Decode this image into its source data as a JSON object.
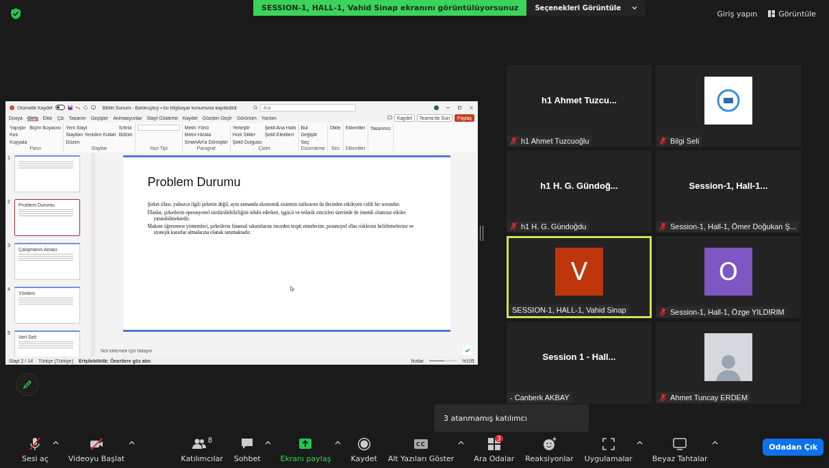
{
  "top_bar": {
    "sharing_banner": "SESSION-1, HALL-1, Vahid Sinap ekranını görüntülüyorsunuz",
    "view_options": "Seçenekleri Görüntüle",
    "sign_in": "Giriş yapın",
    "view": "Görüntüle"
  },
  "shared_screen": {
    "titlebar": {
      "autosave": "Otomatik Kaydet",
      "autosave_on": false,
      "doc_title": "Bildiri Sunum - Bankruptcy • bu bilgisayar konumuna kaydedildi",
      "search_placeholder": "Ara"
    },
    "ribbon_tabs": [
      {
        "label": "Dosya",
        "selected": false
      },
      {
        "label": "Giriş",
        "selected": true
      },
      {
        "label": "Ekle",
        "selected": false
      },
      {
        "label": "Çiz",
        "selected": false
      },
      {
        "label": "Tasarım",
        "selected": false
      },
      {
        "label": "Geçişler",
        "selected": false
      },
      {
        "label": "Animasyonlar",
        "selected": false
      },
      {
        "label": "Slayt Gösterisi",
        "selected": false
      },
      {
        "label": "Kaydet",
        "selected": false
      },
      {
        "label": "Gözden Geçir",
        "selected": false
      },
      {
        "label": "Görünüm",
        "selected": false
      },
      {
        "label": "Yardım",
        "selected": false
      }
    ],
    "ribbon_buttons": [
      {
        "label": "Kaydet",
        "kind": "plain"
      },
      {
        "label": "Teams'de Sun",
        "kind": "plain"
      },
      {
        "label": "Paylaş",
        "kind": "accent"
      }
    ],
    "ribbon_groups": [
      {
        "label": "Pano",
        "items": [
          "Yapıştır",
          "Kes",
          "Kopyala",
          "Biçim Boyacısı"
        ]
      },
      {
        "label": "Slaytlar",
        "items": [
          "Yeni Slayt",
          "Slaytları Yeniden Kullan",
          "Düzen",
          "Sıfırla",
          "Bölüm"
        ]
      },
      {
        "label": "Yazı Tipi"
      },
      {
        "label": "Paragraf",
        "items": [
          "Metin Yönü",
          "Metni Hizala",
          "SmartArt'a Dönüştür"
        ]
      },
      {
        "label": "Çizim",
        "items": [
          "Yerleştir",
          "Hızlı Stiller",
          "Şekil Dolgusu",
          "Şekil Ana Hattı",
          "Şekil Efektleri"
        ]
      },
      {
        "label": "Düzenleme",
        "items": [
          "Bul",
          "Değiştir",
          "Seç"
        ]
      },
      {
        "label": "Ses",
        "items": [
          "Dikte"
        ]
      },
      {
        "label": "Eklentiler",
        "items": [
          "Eklentiler"
        ]
      },
      {
        "items": [
          "Tasarımcı"
        ]
      }
    ],
    "slides": [
      {
        "number": "1",
        "selected": false
      },
      {
        "number": "2",
        "title": "Problem Durumu",
        "selected": true
      },
      {
        "number": "3",
        "title": "Çalışmanın Amacı",
        "selected": false
      },
      {
        "number": "4",
        "title": "Yöntem",
        "selected": false
      },
      {
        "number": "5",
        "title": "Veri Seti",
        "selected": false
      }
    ],
    "slide": {
      "title": "Problem Durumu",
      "bullets": [
        "Şirket iflası, yalnızca ilgili şirketin değil, aynı zamanda ekonomik sistemin istikrarını da derinden etkileyen ciddi bir sorundur.",
        "İflaslar, şirketlerin operasyonel sürdürülebilirliğini tehdit ederken, işgücü ve tedarik zincirleri üzerinde de önemli olumsuz etkiler yaratabilmektedir.",
        "Makine öğrenmesi yöntemleri, şirketlerin finansal sıkıntılarını önceden tespit etmelerine, potansiyel iflas risklerini belirlemelerine ve stratejik kararlar almalarına olanak tanımaktadır."
      ]
    },
    "notes_placeholder": "Not eklemek için tıklayın",
    "status": {
      "slide": "Slayt 2 / 14",
      "language": "Türkçe (Türkiye)",
      "accessibility": "Erişilebilirlik: Önerilere göz atın",
      "notes": "Notlar",
      "zoom_slider": {
        "level": 0.55
      },
      "zoom": "%105"
    }
  },
  "participants": [
    {
      "kind": "name",
      "tile_name": "h1 Ahmet Tuzcu...",
      "label": "h1 Ahmet Tuzcuoğlu",
      "muted": true,
      "speaking": false
    },
    {
      "kind": "logo",
      "label": "Bilgi Seli",
      "muted": true,
      "speaking": false
    },
    {
      "kind": "name",
      "tile_name": "h1 H. G. Gündoğ...",
      "label": "h1 H. G. Gündoğdu",
      "muted": true,
      "speaking": false
    },
    {
      "kind": "name",
      "tile_name": "Session-1,  Hall-1...",
      "label": "Session-1, Hall-1, Ömer Doğukan Ş...",
      "muted": true,
      "speaking": false
    },
    {
      "kind": "avatar",
      "initial": "V",
      "color": "#bf360c",
      "label": "SESSION-1, HALL-1, Vahid Sinap",
      "muted": false,
      "speaking": true
    },
    {
      "kind": "avatar",
      "initial": "O",
      "color": "#7e57c2",
      "label": "Session-1, Hall-1, Özge YILDIRIM",
      "muted": true,
      "speaking": false
    },
    {
      "kind": "name",
      "tile_name": "Session 1 - Hall...",
      "label": "- Canberk AKBAY",
      "muted": false,
      "speaking": false
    },
    {
      "kind": "photo",
      "label": "Ahmet Tuncay ERDEM",
      "muted": true,
      "speaking": false
    }
  ],
  "tooltip": "3 atanmamış katılımcı",
  "toolbar": [
    {
      "kind": "mic-off",
      "label": "Sesi aç",
      "caret": true
    },
    {
      "kind": "video-off",
      "label": "Videoyu Başlat",
      "caret": true
    },
    {
      "kind": "people",
      "label": "Katılımcılar",
      "count": "8",
      "caret": false
    },
    {
      "kind": "chat",
      "label": "Sohbet",
      "caret": true
    },
    {
      "kind": "share",
      "label": "Ekranı paylaş",
      "caret": true
    },
    {
      "kind": "record",
      "label": "Kaydet",
      "caret": false
    },
    {
      "kind": "cc",
      "label": "Alt Yazıları Göster",
      "caret": true
    },
    {
      "kind": "rooms",
      "label": "Ara Odalar",
      "badge": "3",
      "caret": false
    },
    {
      "kind": "reaction",
      "label": "Reaksiyonlar",
      "caret": false
    },
    {
      "kind": "apps",
      "label": "Uygulamalar",
      "caret": true
    },
    {
      "kind": "whiteboard",
      "label": "Beyaz Tahtalar",
      "caret": true
    }
  ],
  "leave_button": "Odadan Çık"
}
